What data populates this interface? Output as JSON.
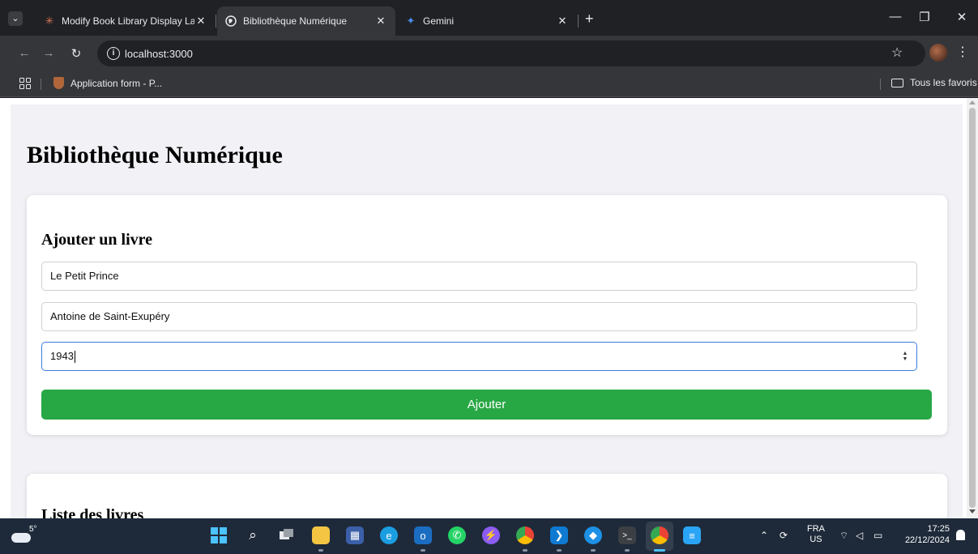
{
  "browser": {
    "tabs": [
      {
        "title": "Modify Book Library Display La",
        "favicon": "claude-sparkle-icon",
        "color": "#d97757"
      },
      {
        "title": "Bibliothèque Numérique",
        "favicon": "globe-icon",
        "color": "#e8eaed"
      },
      {
        "title": "Gemini",
        "favicon": "gemini-star-icon",
        "color": "#4b8bf5"
      }
    ],
    "url": "localhost:3000",
    "bookmarks": [
      {
        "label": "Application form - P..."
      }
    ],
    "all_bookmarks_label": "Tous les favoris"
  },
  "page": {
    "title": "Bibliothèque Numérique",
    "add_section": {
      "heading": "Ajouter un livre",
      "title_value": "Le Petit Prince",
      "author_value": "Antoine de Saint-Exupéry",
      "year_value": "1943",
      "submit_label": "Ajouter",
      "submit_color": "#28a745"
    },
    "list_section": {
      "heading": "Liste des livres"
    }
  },
  "taskbar": {
    "weather_temp": "5°",
    "language_top": "FRA",
    "language_bottom": "US",
    "time": "17:25",
    "date": "22/12/2024"
  }
}
